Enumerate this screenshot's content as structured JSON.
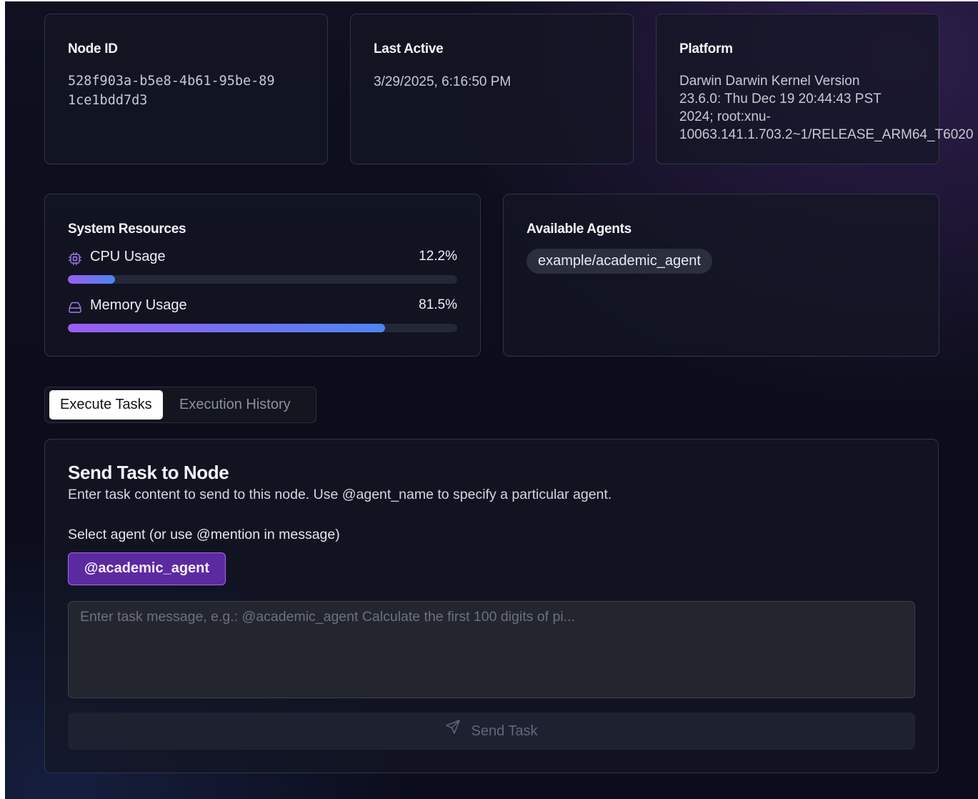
{
  "node_id": {
    "label": "Node ID",
    "value_line1": "528f903a-b5e8-4b61-95be-89",
    "value_line2": "1ce1bdd7d3"
  },
  "last_active": {
    "label": "Last Active",
    "value": "3/29/2025, 6:16:50 PM"
  },
  "platform": {
    "label": "Platform",
    "lines": [
      "Darwin Darwin Kernel Version",
      "23.6.0: Thu Dec 19 20:44:43 PST",
      "2024; root:xnu-",
      "10063.141.1.703.2~1/RELEASE_ARM64_T6020"
    ]
  },
  "system_resources": {
    "label": "System Resources",
    "cpu": {
      "label": "CPU Usage",
      "value_text": "12.2%",
      "fraction": 0.122,
      "icon": "cpu-icon"
    },
    "memory": {
      "label": "Memory Usage",
      "value_text": "81.5%",
      "fraction": 0.815,
      "icon": "hard-drive-icon"
    }
  },
  "available_agents": {
    "label": "Available Agents",
    "items": [
      "example/academic_agent"
    ]
  },
  "tabs": [
    {
      "label": "Execute Tasks",
      "active": true
    },
    {
      "label": "Execution History",
      "active": false
    }
  ],
  "task": {
    "title": "Send Task to Node",
    "description": "Enter task content to send to this node. Use @agent_name to specify a particular agent.",
    "select_label": "Select agent (or use @mention in message)",
    "agent_button": "@academic_agent",
    "input_value": "",
    "input_placeholder": "Enter task message, e.g.: @academic_agent Calculate the first 100 digits of pi...",
    "send_label": "Send Task",
    "send_icon": "send-icon"
  },
  "colors": {
    "accent_purple": "#5b2aa0",
    "accent_border": "#a06af0",
    "bar_gradient_start": "#9b5cf2",
    "bar_gradient_end": "#4d86f0"
  }
}
